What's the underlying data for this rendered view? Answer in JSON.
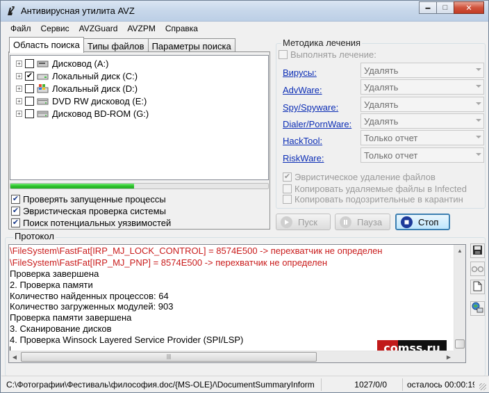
{
  "window": {
    "title": "Антивирусная утилита AVZ",
    "icon_name": "avz-app-icon"
  },
  "titlebar_buttons": {
    "minimize": "▬",
    "maximize": "□",
    "close": "✕"
  },
  "menu": [
    "Файл",
    "Сервис",
    "AVZGuard",
    "AVZPM",
    "Справка"
  ],
  "tabs": [
    "Область поиска",
    "Типы файлов",
    "Параметры поиска"
  ],
  "drives": [
    {
      "label": "Дисковод (A:)",
      "checked": false,
      "icon": "floppy-drive-icon"
    },
    {
      "label": "Локальный диск (C:)",
      "checked": true,
      "icon": "hard-drive-icon"
    },
    {
      "label": "Локальный диск (D:)",
      "checked": false,
      "icon": "windows-drive-icon"
    },
    {
      "label": "DVD RW дисковод (E:)",
      "checked": false,
      "icon": "dvd-drive-icon"
    },
    {
      "label": "Дисковод BD-ROM (G:)",
      "checked": false,
      "icon": "bd-drive-icon"
    }
  ],
  "scan_progress": 0.48,
  "options": [
    {
      "label": "Проверять запущенные процессы",
      "checked": true
    },
    {
      "label": "Эвристическая проверка системы",
      "checked": true
    },
    {
      "label": "Поиск потенциальных уязвимостей",
      "checked": true
    }
  ],
  "method": {
    "legend": "Методика лечения",
    "perform_label": "Выполнять лечение:",
    "rows": [
      {
        "link": "Вирусы:",
        "value": "Удалять"
      },
      {
        "link": "AdvWare:",
        "value": "Удалять"
      },
      {
        "link": "Spy/Spyware:",
        "value": "Удалять"
      },
      {
        "link": "Dialer/PornWare:",
        "value": "Удалять"
      },
      {
        "link": "HackTool:",
        "value": "Только отчет"
      },
      {
        "link": "RiskWare:",
        "value": "Только отчет"
      }
    ],
    "heuristic_delete": "Эвристическое удаление файлов",
    "copy_deleted": "Копировать удаляемые файлы в  Infected",
    "copy_suspicious": "Копировать подозрительные в  карантин"
  },
  "buttons": {
    "start": "Пуск",
    "pause": "Пауза",
    "stop": "Стоп"
  },
  "protocol": {
    "legend": "Протокол",
    "lines": [
      {
        "text": "\\FileSystem\\FastFat[IRP_MJ_LOCK_CONTROL] = 8574E500 -> перехватчик не определен",
        "color": "red"
      },
      {
        "text": "\\FileSystem\\FastFat[IRP_MJ_PNP] = 8574E500 -> перехватчик не определен",
        "color": "red"
      },
      {
        "text": " Проверка завершена",
        "color": "black"
      },
      {
        "text": "2. Проверка памяти",
        "color": "black"
      },
      {
        "text": " Количество найденных процессов: 64",
        "color": "black"
      },
      {
        "text": " Количество загруженных модулей: 903",
        "color": "black"
      },
      {
        "text": "Проверка памяти завершена",
        "color": "black"
      },
      {
        "text": "3. Сканирование дисков",
        "color": "black"
      },
      {
        "text": "4. Проверка Winsock Layered Service Provider (SPI/LSP)",
        "color": "black"
      }
    ],
    "hscroll_grip": "|||",
    "watermark": "comss.ru"
  },
  "side_tools": [
    "save-icon",
    "glasses-icon",
    "new-document-icon",
    "network-icon"
  ],
  "status": {
    "path": "C:\\Фотографии\\Фестиваль\\философия.doc/{MS-OLE}/\\DocumentSummaryInform",
    "counts": "1027/0/0",
    "remaining": "осталось 00:00:19"
  },
  "colors": {
    "log_error": "#c91b1b",
    "link": "#0b2db5",
    "progress": "#2ec02e",
    "stop_accent": "#3c7fb1"
  }
}
